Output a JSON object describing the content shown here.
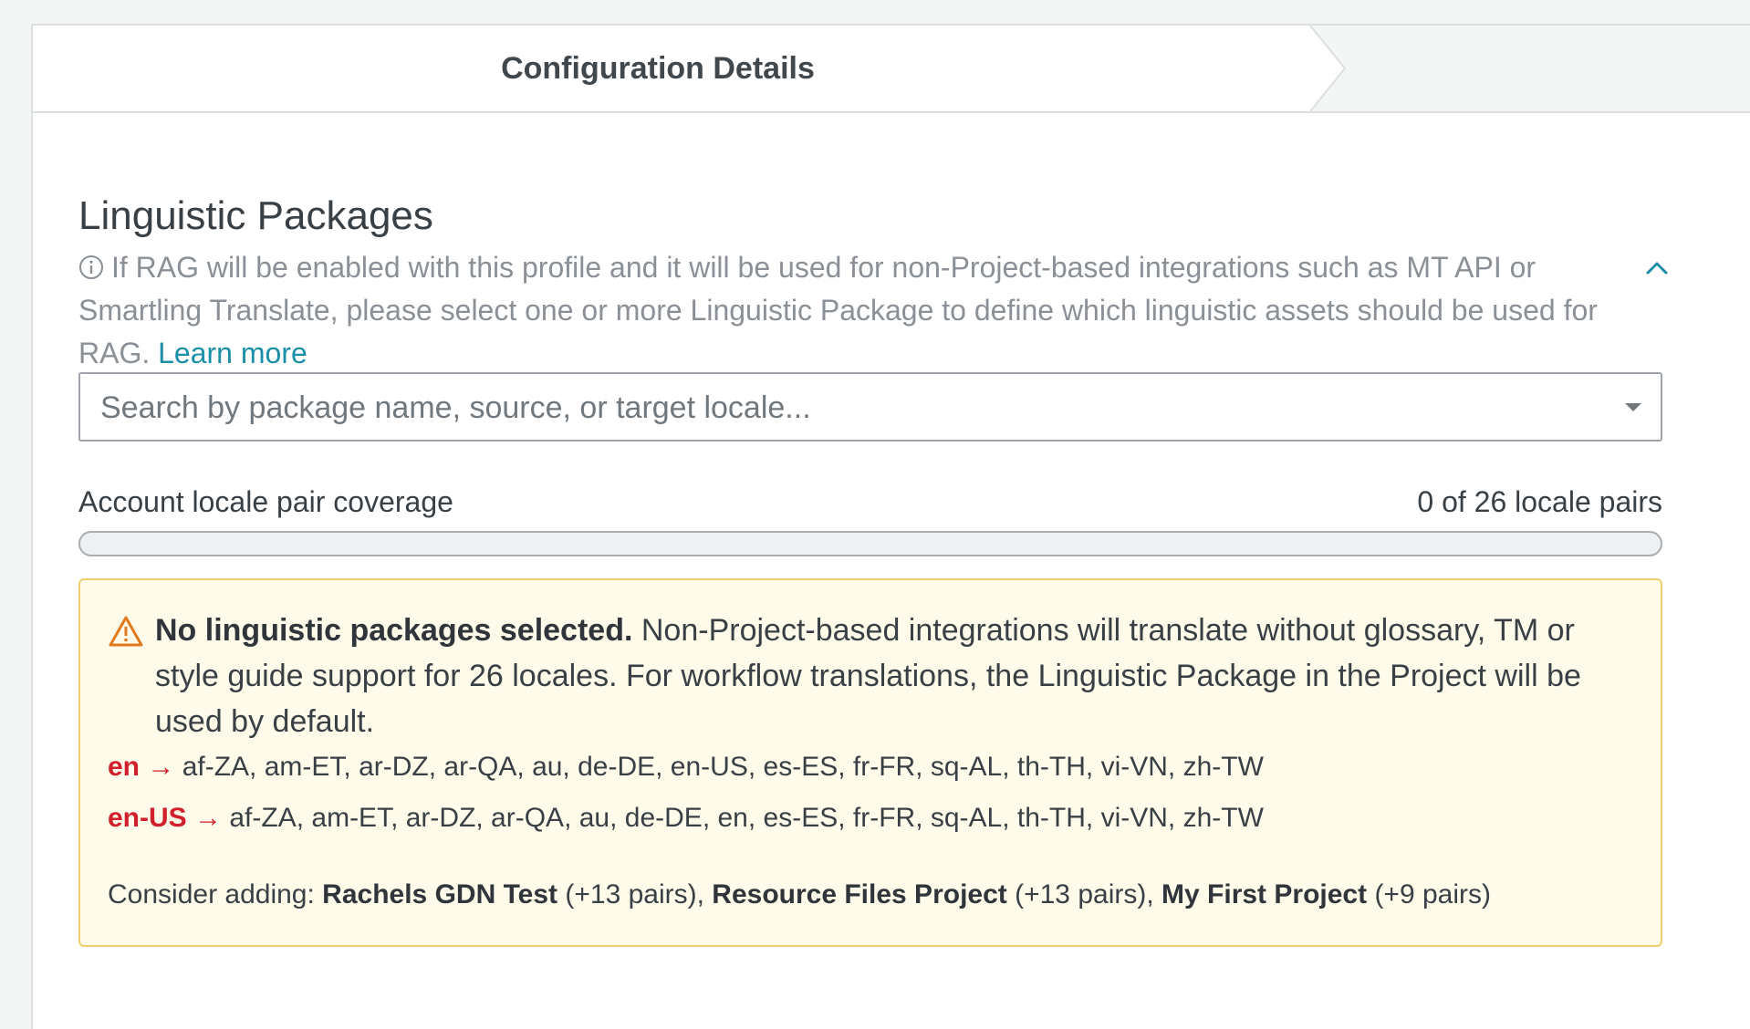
{
  "stepper": {
    "active_step": "Configuration Details"
  },
  "section": {
    "title": "Linguistic Packages",
    "description": "If RAG will be enabled with this profile and it will be used for non-Project-based integrations such as MT API or Smartling Translate, please select one or more Linguistic Package to define which linguistic assets should be used for RAG.",
    "learn_more": "Learn more"
  },
  "search": {
    "placeholder": "Search by package name, source, or target locale..."
  },
  "coverage": {
    "label": "Account locale pair coverage",
    "count_text": "0 of 26 locale pairs",
    "covered": 0,
    "total": 26
  },
  "warning": {
    "title": "No linguistic packages selected.",
    "message": "Non-Project-based integrations will translate without glossary, TM or style guide support for 26 locales. For workflow translations, the Linguistic Package in the Project will be used by default.",
    "locale_rows": [
      {
        "source": "en",
        "arrow": "→",
        "targets": "af-ZA, am-ET, ar-DZ, ar-QA, au, de-DE, en-US, es-ES, fr-FR, sq-AL, th-TH, vi-VN, zh-TW"
      },
      {
        "source": "en-US",
        "arrow": "→",
        "targets": "af-ZA, am-ET, ar-DZ, ar-QA, au, de-DE, en, es-ES, fr-FR, sq-AL, th-TH, vi-VN, zh-TW"
      }
    ],
    "consider_label": "Consider adding:",
    "suggestions": [
      {
        "name": "Rachels GDN Test",
        "pairs": "(+13 pairs)",
        "sep": ","
      },
      {
        "name": "Resource Files Project",
        "pairs": "(+13 pairs)",
        "sep": ","
      },
      {
        "name": "My First Project",
        "pairs": "(+9 pairs)",
        "sep": ""
      }
    ]
  },
  "colors": {
    "accent": "#1a8fa8",
    "warning_border": "#f1cf6e",
    "warning_bg": "#fffbea",
    "warning_icon": "#e07a1f",
    "locale_source": "#d0202b"
  },
  "icons": {
    "info": "info-circle-icon",
    "collapse": "chevron-up-icon",
    "dropdown": "caret-down-icon",
    "warning": "warning-triangle-icon"
  }
}
